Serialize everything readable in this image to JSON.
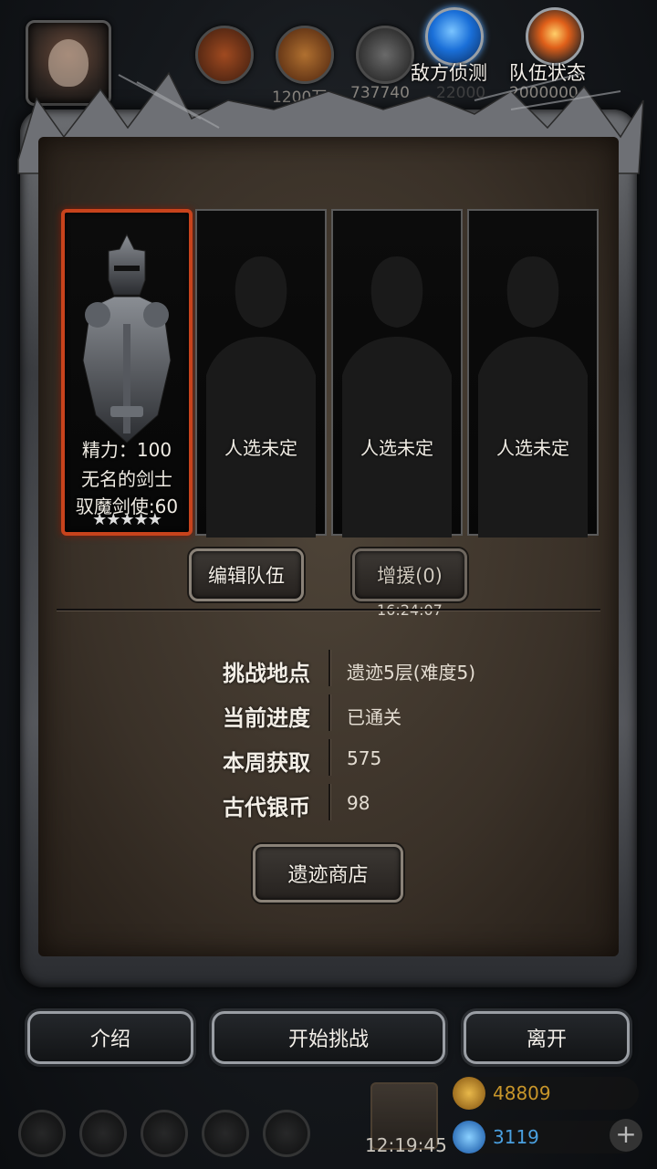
{
  "top_bar": {
    "resources": [
      {
        "icon": "ore-icon",
        "value": ""
      },
      {
        "icon": "wood-icon",
        "value": "1200万"
      },
      {
        "icon": "stone-icon",
        "value": "737740"
      }
    ],
    "hidden_values": [
      "22000",
      "2000000"
    ],
    "scout_label": "敌方侦测",
    "status_label": "队伍状态"
  },
  "slots": [
    {
      "filled": true,
      "energy": "精力：100",
      "name": "无名的剑士",
      "job": "驭魔剑使:60",
      "stars": "★★★★★"
    },
    {
      "filled": false,
      "label": "人选未定"
    },
    {
      "filled": false,
      "label": "人选未定"
    },
    {
      "filled": false,
      "label": "人选未定"
    }
  ],
  "buttons": {
    "edit_team": "编辑队伍",
    "reinforce": "增援(0)",
    "reinforce_timer": "16:24:07",
    "shop": "遗迹商店"
  },
  "info": [
    {
      "label": "挑战地点",
      "value": "遗迹5层(难度5)"
    },
    {
      "label": "当前进度",
      "value": "已通关"
    },
    {
      "label": "本周获取",
      "value": "575"
    },
    {
      "label": "古代银币",
      "value": "98"
    }
  ],
  "bottom": {
    "intro": "介绍",
    "start": "开始挑战",
    "leave": "离开",
    "clock": "12:19:45",
    "gold": "48809",
    "gems": "3119",
    "gold_color": "#c8962a",
    "gem_color": "#4aa0e0"
  }
}
